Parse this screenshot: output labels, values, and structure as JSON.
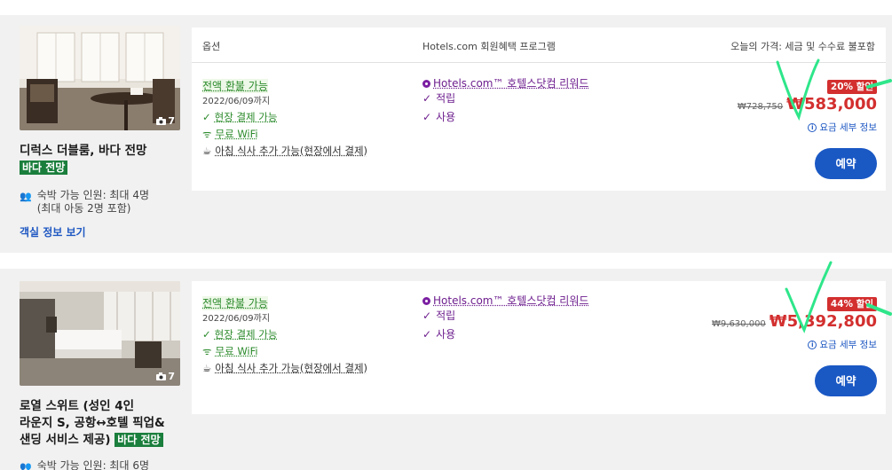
{
  "header": {
    "options": "옵션",
    "program": "Hotels.com 회원혜택 프로그램",
    "price_note": "오늘의 가격: 세금 및 수수료 불포함"
  },
  "rooms": [
    {
      "photo_count": "7",
      "name": "디럭스 더블룸, 바다 전망",
      "view_badge": "바다 전망",
      "capacity_line1": "숙박 가능 인원: 최대 4명",
      "capacity_line2": "(최대 아동 2명 포함)",
      "room_info_link": "객실 정보 보기",
      "option": {
        "refund": "전액 환불 가능",
        "deadline": "2022/06/09까지",
        "pay_at_property": "현장 결제 가능",
        "wifi": "무료 WiFi",
        "breakfast": "아침 식사 추가 가능(현장에서 결제)"
      },
      "program": {
        "reward_link": "Hotels.com™ 호텔스닷컴 리워드",
        "earn": "적립",
        "use": "사용"
      },
      "price": {
        "discount": "20% 할인",
        "old": "₩728,750",
        "new": "₩583,000",
        "fee_link": "요금 세부 정보",
        "reserve": "예약"
      }
    },
    {
      "photo_count": "7",
      "name_line1": "로열 스위트 (성인 4인",
      "name_line2": "라운지 S, 공항↔호텔 픽업&",
      "name_line3": "샌딩 서비스 제공)",
      "view_badge": "바다 전망",
      "capacity_line1": "숙박 가능 인원: 최대 6명",
      "option": {
        "refund": "전액 환불 가능",
        "deadline": "2022/06/09까지",
        "pay_at_property": "현장 결제 가능",
        "wifi": "무료 WiFi",
        "breakfast": "아침 식사 추가 가능(현장에서 결제)"
      },
      "program": {
        "reward_link": "Hotels.com™ 호텔스닷컴 리워드",
        "earn": "적립",
        "use": "사용"
      },
      "price": {
        "discount": "44% 할인",
        "old": "₩9,630,000",
        "new": "₩5,392,800",
        "fee_link": "요금 세부 정보",
        "reserve": "예약"
      }
    }
  ],
  "colors": {
    "green": "#2b8a2b",
    "badge_green": "#1a7e3c",
    "price_red": "#d32f2f",
    "button_blue": "#1a58c4",
    "purple": "#6d1e8e",
    "annotation_green": "#2ee68a"
  },
  "icons": [
    "camera-icon",
    "people-icon",
    "check-icon",
    "wifi-icon",
    "coffee-icon",
    "reward-dot-icon",
    "info-icon"
  ]
}
